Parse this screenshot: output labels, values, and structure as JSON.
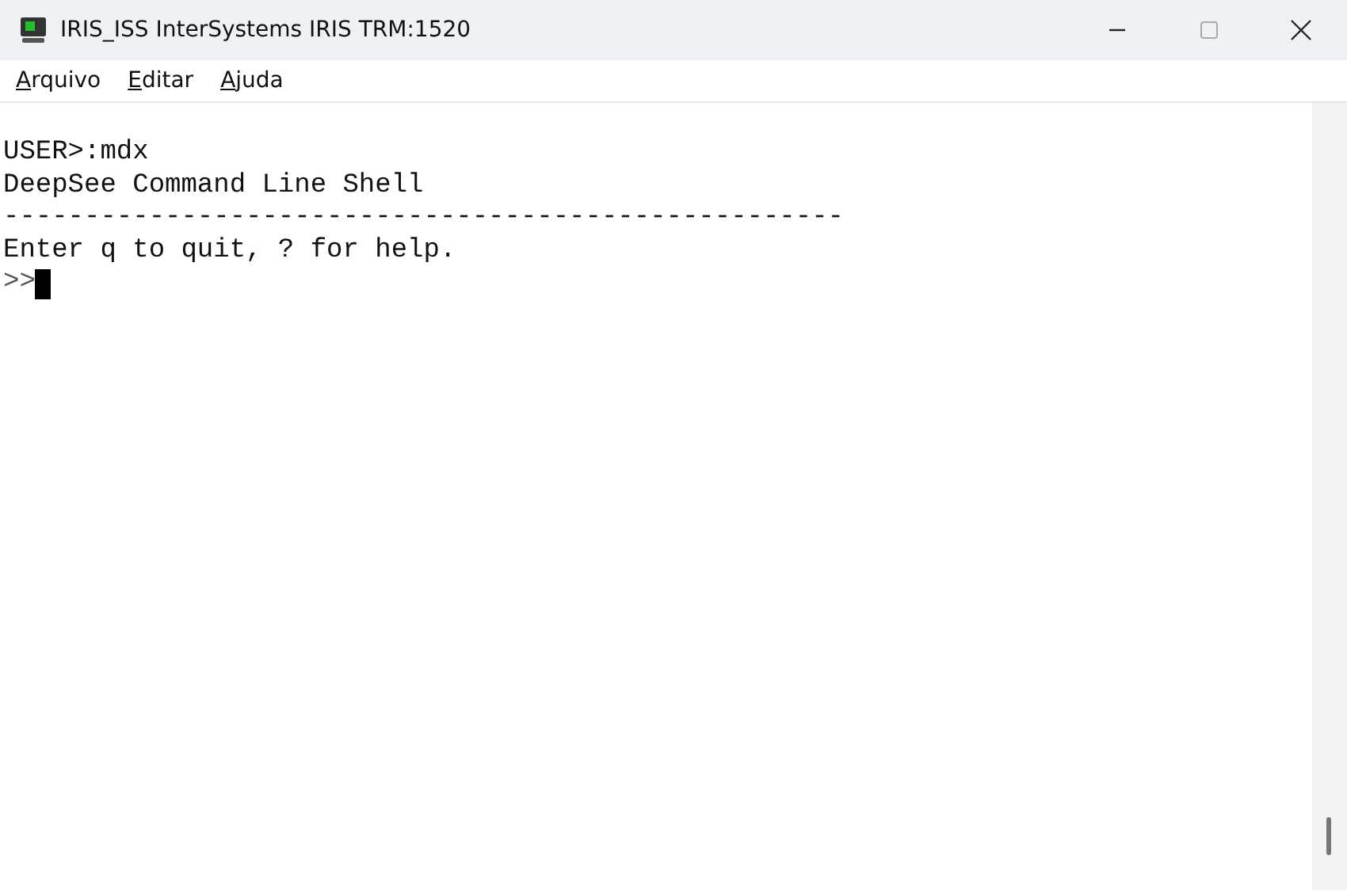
{
  "window": {
    "title": "IRIS_ISS InterSystems IRIS TRM:1520"
  },
  "menu": [
    {
      "label": "Arquivo"
    },
    {
      "label": "Editar"
    },
    {
      "label": "Ajuda"
    }
  ],
  "terminal": {
    "lines": [
      "USER>:mdx",
      "DeepSee Command Line Shell",
      "----------------------------------------------------",
      "Enter q to quit, ? for help."
    ],
    "prompt": ">>"
  }
}
